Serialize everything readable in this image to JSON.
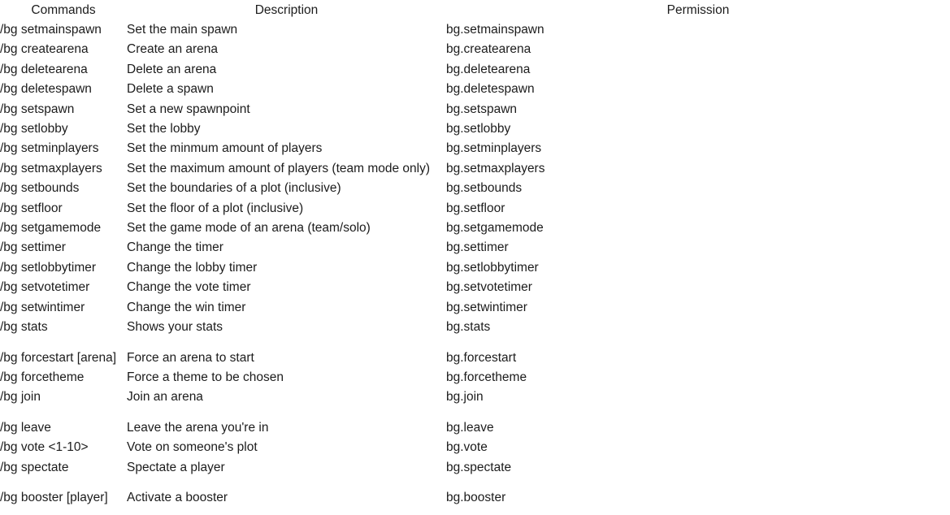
{
  "table": {
    "headers": {
      "command": "Commands",
      "description": "Description",
      "permission": "Permission"
    },
    "sections": [
      {
        "rows": [
          {
            "command": "/bg setmainspawn",
            "description": "Set the main spawn",
            "permission": "bg.setmainspawn"
          },
          {
            "command": "/bg createarena",
            "description": "Create an arena",
            "permission": "bg.createarena"
          },
          {
            "command": "/bg deletearena",
            "description": "Delete an arena",
            "permission": "bg.deletearena"
          },
          {
            "command": "/bg deletespawn",
            "description": "Delete a spawn",
            "permission": "bg.deletespawn"
          },
          {
            "command": "/bg setspawn",
            "description": "Set a new spawnpoint",
            "permission": "bg.setspawn"
          },
          {
            "command": "/bg setlobby",
            "description": "Set the lobby",
            "permission": "bg.setlobby"
          },
          {
            "command": "/bg setminplayers",
            "description": "Set the minmum amount of players",
            "permission": "bg.setminplayers"
          },
          {
            "command": "/bg setmaxplayers",
            "description": "Set the maximum amount of players (team mode only)",
            "permission": "bg.setmaxplayers"
          },
          {
            "command": "/bg setbounds",
            "description": "Set the boundaries of a plot (inclusive)",
            "permission": "bg.setbounds"
          },
          {
            "command": "/bg setfloor",
            "description": "Set the floor of a plot (inclusive)",
            "permission": "bg.setfloor"
          },
          {
            "command": "/bg setgamemode",
            "description": "Set the game mode of an arena (team/solo)",
            "permission": "bg.setgamemode"
          },
          {
            "command": "/bg settimer",
            "description": "Change the timer",
            "permission": "bg.settimer"
          },
          {
            "command": "/bg setlobbytimer",
            "description": "Change the lobby timer",
            "permission": "bg.setlobbytimer"
          },
          {
            "command": "/bg setvotetimer",
            "description": "Change the vote timer",
            "permission": "bg.setvotetimer"
          },
          {
            "command": "/bg setwintimer",
            "description": "Change the win timer",
            "permission": "bg.setwintimer"
          },
          {
            "command": "/bg stats",
            "description": "Shows your stats",
            "permission": "bg.stats"
          }
        ]
      },
      {
        "rows": [
          {
            "command": "/bg forcestart [arena]",
            "description": "Force an arena to start",
            "permission": "bg.forcestart"
          },
          {
            "command": "/bg forcetheme",
            "description": "Force a theme to be chosen",
            "permission": "bg.forcetheme"
          },
          {
            "command": "/bg join",
            "description": "Join an arena",
            "permission": "bg.join"
          }
        ]
      },
      {
        "rows": [
          {
            "command": "/bg leave",
            "description": "Leave the arena you're in",
            "permission": "bg.leave"
          },
          {
            "command": "/bg vote <1-10>",
            "description": "Vote on someone's plot",
            "permission": "bg.vote"
          },
          {
            "command": "/bg spectate",
            "description": "Spectate a player",
            "permission": "bg.spectate"
          }
        ]
      },
      {
        "rows": [
          {
            "command": "/bg booster [player]",
            "description": "Activate a booster",
            "permission": "bg.booster"
          }
        ]
      }
    ]
  }
}
